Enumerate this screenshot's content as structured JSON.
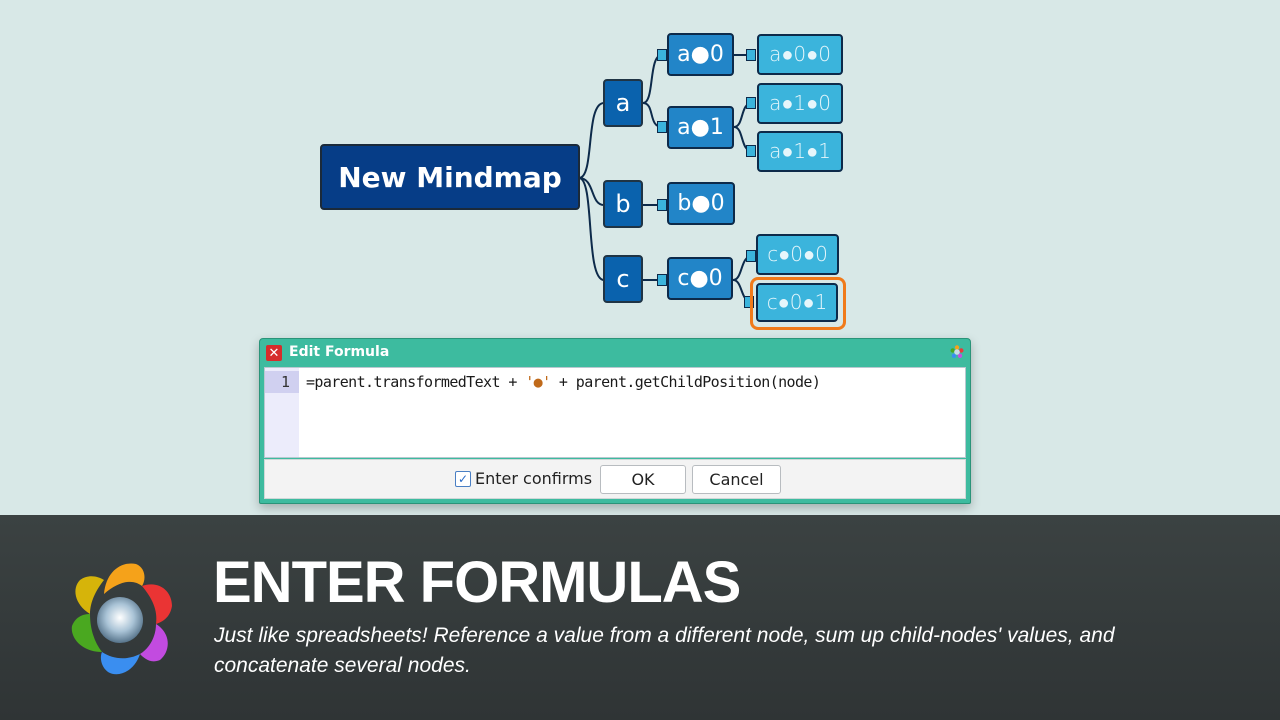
{
  "mindmap": {
    "root": {
      "label": "New Mindmap"
    },
    "nodes": {
      "a": "a",
      "b": "b",
      "c": "c",
      "a0": "a●0",
      "a1": "a●1",
      "b0": "b●0",
      "c0": "c●0",
      "a00": "a●0●0",
      "a10": "a●1●0",
      "a11": "a●1●1",
      "c00": "c●0●0",
      "c01": "c●0●1"
    },
    "selected_node": "c01",
    "colors": {
      "root": "#063d87",
      "level1": "#0a62ad",
      "level2": "#2285c8",
      "level3": "#3bb4dc",
      "selection": "#f07a1a",
      "edge": "#0d2a4a"
    }
  },
  "dialog": {
    "title": "Edit Formula",
    "close_icon": "close-icon",
    "app_icon": "freeplane-logo-icon",
    "editor": {
      "line_number": "1",
      "code_before": "=parent.transformedText + ",
      "code_string": "'●'",
      "code_after": " + parent.getChildPosition(node)"
    },
    "enter_confirms": {
      "label": "Enter confirms",
      "checked": true
    },
    "ok_label": "OK",
    "cancel_label": "Cancel",
    "colors": {
      "titlebar": "#3dbb9f",
      "close": "#d62c2c"
    }
  },
  "banner": {
    "headline": "ENTER FORMULAS",
    "description": "Just like spreadsheets! Reference a value from a different node, sum up child-nodes' values, and concatenate several nodes.",
    "logo_icon": "freeplane-logo-icon"
  }
}
